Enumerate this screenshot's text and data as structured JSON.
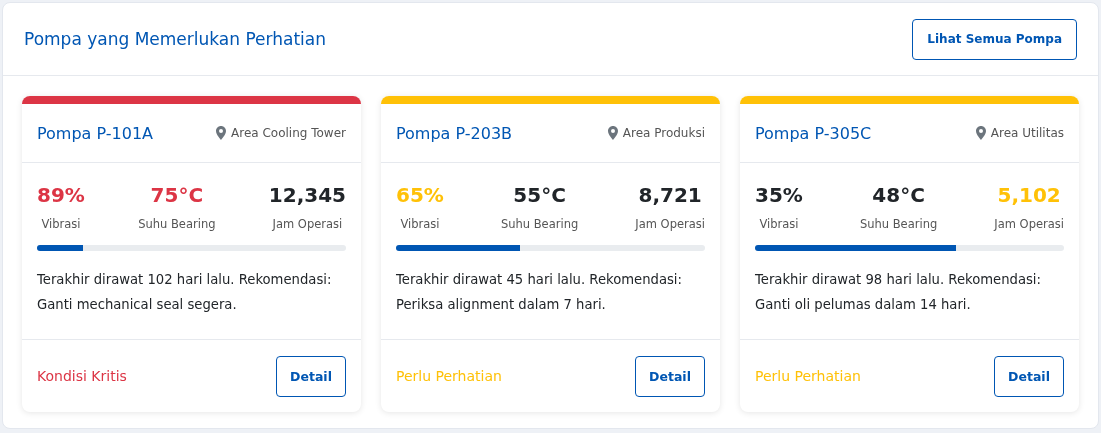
{
  "panel": {
    "title": "Pompa yang Memerlukan Perhatian",
    "action": "Lihat Semua Pompa"
  },
  "pumps": [
    {
      "name": "Pompa P-101A",
      "location": "Area Cooling Tower",
      "color": "#dc3545",
      "metrics": [
        {
          "value": "89%",
          "label": "Vibrasi",
          "color": "#dc3545"
        },
        {
          "value": "75°C",
          "label": "Suhu Bearing",
          "color": "#dc3545"
        },
        {
          "value": "12,345",
          "label": "Jam Operasi",
          "color": "#212529"
        }
      ],
      "level": 0.15,
      "note": "Terakhir dirawat 102 hari lalu. Rekomendasi: Ganti mechanical seal segera.",
      "status": "Kondisi Kritis",
      "button": "Detail"
    },
    {
      "name": "Pompa P-203B",
      "location": "Area Produksi",
      "color": "#ffc107",
      "metrics": [
        {
          "value": "65%",
          "label": "Vibrasi",
          "color": "#ffc107"
        },
        {
          "value": "55°C",
          "label": "Suhu Bearing",
          "color": "#212529"
        },
        {
          "value": "8,721",
          "label": "Jam Operasi",
          "color": "#212529"
        }
      ],
      "level": 0.4,
      "note": "Terakhir dirawat 45 hari lalu. Rekomendasi: Periksa alignment dalam 7 hari.",
      "status": "Perlu Perhatian",
      "button": "Detail"
    },
    {
      "name": "Pompa P-305C",
      "location": "Area Utilitas",
      "color": "#ffc107",
      "metrics": [
        {
          "value": "35%",
          "label": "Vibrasi",
          "color": "#212529"
        },
        {
          "value": "48°C",
          "label": "Suhu Bearing",
          "color": "#212529"
        },
        {
          "value": "5,102",
          "label": "Jam Operasi",
          "color": "#ffc107"
        }
      ],
      "level": 0.65,
      "note": "Terakhir dirawat 98 hari lalu. Rekomendasi: Ganti oli pelumas dalam 14 hari.",
      "status": "Perlu Perhatian",
      "button": "Detail"
    }
  ]
}
